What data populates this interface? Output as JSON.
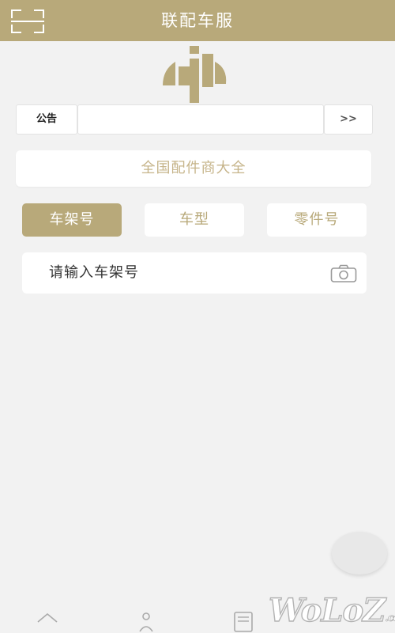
{
  "header": {
    "title": "联配车服",
    "background_color": "#b8a97a",
    "scan_icon": "scan-icon"
  },
  "logo": {
    "icon": "brand-logo-icon"
  },
  "notice": {
    "label": "公告",
    "content": "",
    "more_label": ">>"
  },
  "dealer_button": {
    "label": "全国配件商大全"
  },
  "tabs": [
    {
      "label": "车架号",
      "active": true
    },
    {
      "label": "车型",
      "active": false
    },
    {
      "label": "零件号",
      "active": false
    }
  ],
  "search": {
    "placeholder": "请输入车架号",
    "camera_icon": "camera-icon"
  },
  "bottom_nav": {
    "icons": [
      "home-icon",
      "user-icon",
      "list-icon"
    ]
  },
  "watermark": {
    "text": "WoLoZ",
    "suffix": ".com"
  },
  "colors": {
    "accent": "#b8a97a",
    "accent_text": "#c6b48a",
    "background": "#f2f2f2"
  }
}
